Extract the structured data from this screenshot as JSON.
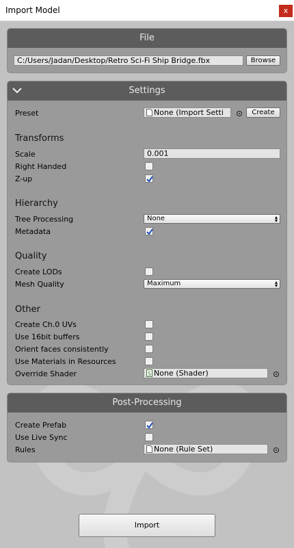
{
  "window": {
    "title": "Import Model",
    "close_label": "x"
  },
  "file": {
    "header": "File",
    "path": "C:/Users/Jadan/Desktop/Retro Sci-Fi Ship Bridge.fbx",
    "browse_label": "Browse"
  },
  "settings": {
    "header": "Settings",
    "preset_label": "Preset",
    "preset_value": "None (Import Setti",
    "create_label": "Create",
    "transforms": {
      "title": "Transforms",
      "scale_label": "Scale",
      "scale_value": "0.001",
      "right_handed_label": "Right Handed",
      "right_handed_checked": false,
      "zup_label": "Z-up",
      "zup_checked": true
    },
    "hierarchy": {
      "title": "Hierarchy",
      "tree_label": "Tree Processing",
      "tree_value": "None",
      "metadata_label": "Metadata",
      "metadata_checked": true
    },
    "quality": {
      "title": "Quality",
      "lods_label": "Create LODs",
      "lods_checked": false,
      "mesh_label": "Mesh Quality",
      "mesh_value": "Maximum"
    },
    "other": {
      "title": "Other",
      "uv_label": "Create Ch.0 UVs",
      "uv_checked": false,
      "buffers_label": "Use 16bit buffers",
      "buffers_checked": false,
      "orient_label": "Orient faces consistently",
      "orient_checked": false,
      "materials_label": "Use Materials in Resources",
      "materials_checked": false,
      "shader_label": "Override Shader",
      "shader_value": "None (Shader)"
    }
  },
  "post": {
    "header": "Post-Processing",
    "prefab_label": "Create Prefab",
    "prefab_checked": true,
    "sync_label": "Use Live Sync",
    "sync_checked": false,
    "rules_label": "Rules",
    "rules_value": "None (Rule Set)"
  },
  "import_label": "Import",
  "icons": {
    "close": "close-icon",
    "collapse": "chevron-down-icon",
    "check": "checkmark-icon",
    "dropdown": "dropdown-arrows-icon",
    "object": "document-icon",
    "script": "script-icon",
    "picker": "object-picker-icon",
    "logo": "background-logo-icon"
  },
  "colors": {
    "header_bg": "#5c5c5c",
    "panel_bg": "#9a9a9a",
    "window_bg": "#c2c2c2",
    "close_bg": "#c42b1c",
    "check_color": "#1f4fb3"
  }
}
